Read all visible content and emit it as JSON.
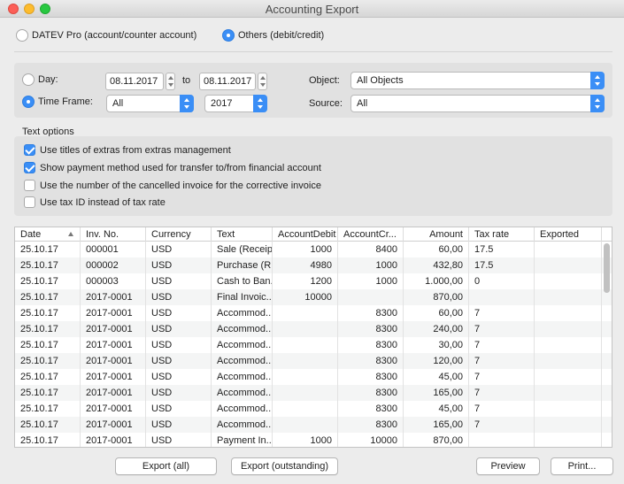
{
  "window": {
    "title": "Accounting Export"
  },
  "format": {
    "datev_label": "DATEV Pro (account/counter account)",
    "others_label": "Others (debit/credit)",
    "selected": "others"
  },
  "filters": {
    "day_label": "Day:",
    "timeframe_label": "Time Frame:",
    "selected": "timeframe",
    "date_from": "08.11.2017",
    "to_label": "to",
    "date_to": "08.11.2017",
    "period": "All",
    "year": "2017",
    "object_label": "Object:",
    "object_value": "All Objects",
    "source_label": "Source:",
    "source_value": "All"
  },
  "text_options": {
    "heading": "Text options",
    "items": [
      {
        "label": "Use titles of extras from extras management",
        "checked": true
      },
      {
        "label": "Show payment method used for transfer to/from financial account",
        "checked": true
      },
      {
        "label": "Use the number of the cancelled invoice for the corrective invoice",
        "checked": false
      },
      {
        "label": "Use tax ID instead of tax rate",
        "checked": false
      }
    ]
  },
  "table": {
    "columns": [
      "Date",
      "Inv. No.",
      "Currency",
      "Text",
      "AccountDebit",
      "AccountCr...",
      "Amount",
      "Tax rate",
      "Exported"
    ],
    "rows": [
      [
        "25.10.17",
        "000001",
        "USD",
        "Sale (Receip...",
        "1000",
        "8400",
        "60,00",
        "17.5",
        ""
      ],
      [
        "25.10.17",
        "000002",
        "USD",
        "Purchase (R...",
        "4980",
        "1000",
        "432,80",
        "17.5",
        ""
      ],
      [
        "25.10.17",
        "000003",
        "USD",
        "Cash to Ban...",
        "1200",
        "1000",
        "1.000,00",
        "0",
        ""
      ],
      [
        "25.10.17",
        "2017-0001",
        "USD",
        "Final Invoic...",
        "10000",
        "",
        "870,00",
        "",
        ""
      ],
      [
        "25.10.17",
        "2017-0001",
        "USD",
        "Accommod...",
        "",
        "8300",
        "60,00",
        "7",
        ""
      ],
      [
        "25.10.17",
        "2017-0001",
        "USD",
        "Accommod...",
        "",
        "8300",
        "240,00",
        "7",
        ""
      ],
      [
        "25.10.17",
        "2017-0001",
        "USD",
        "Accommod...",
        "",
        "8300",
        "30,00",
        "7",
        ""
      ],
      [
        "25.10.17",
        "2017-0001",
        "USD",
        "Accommod...",
        "",
        "8300",
        "120,00",
        "7",
        ""
      ],
      [
        "25.10.17",
        "2017-0001",
        "USD",
        "Accommod...",
        "",
        "8300",
        "45,00",
        "7",
        ""
      ],
      [
        "25.10.17",
        "2017-0001",
        "USD",
        "Accommod...",
        "",
        "8300",
        "165,00",
        "7",
        ""
      ],
      [
        "25.10.17",
        "2017-0001",
        "USD",
        "Accommod...",
        "",
        "8300",
        "45,00",
        "7",
        ""
      ],
      [
        "25.10.17",
        "2017-0001",
        "USD",
        "Accommod...",
        "",
        "8300",
        "165,00",
        "7",
        ""
      ],
      [
        "25.10.17",
        "2017-0001",
        "USD",
        "Payment In...",
        "1000",
        "10000",
        "870,00",
        "",
        ""
      ]
    ]
  },
  "buttons": {
    "export_all": "Export (all)",
    "export_outstanding": "Export (outstanding)",
    "preview": "Preview",
    "print": "Print..."
  }
}
